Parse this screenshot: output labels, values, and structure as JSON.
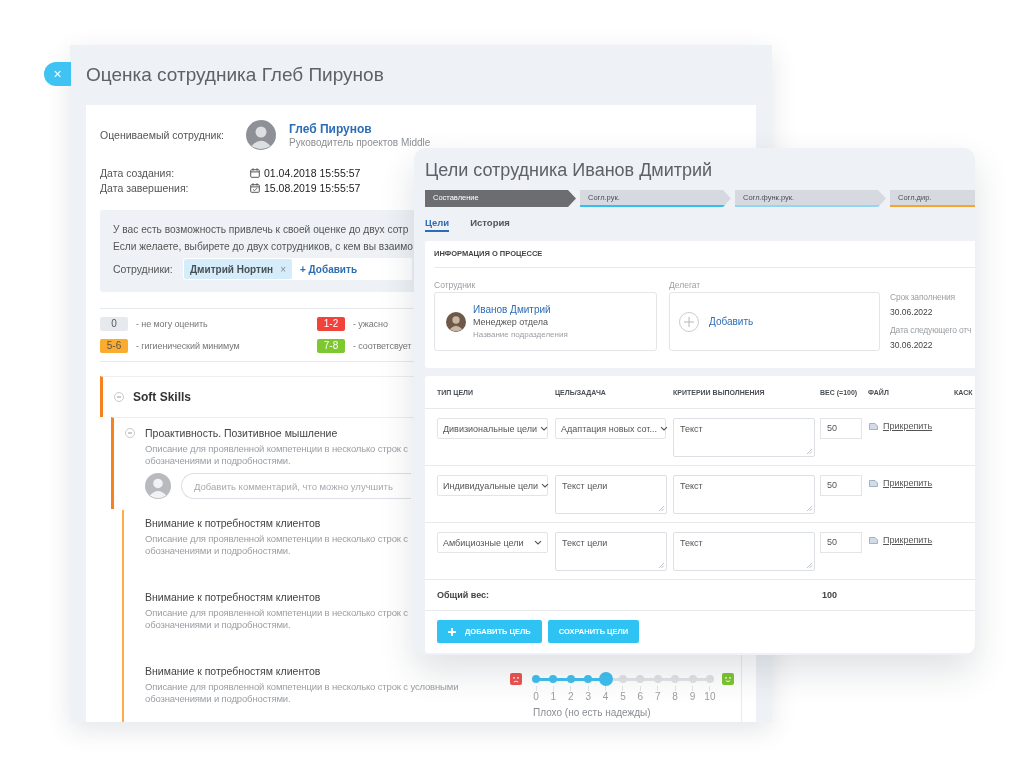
{
  "evaluation_window": {
    "close": "×",
    "title": "Оценка сотрудника Глеб Пирунов",
    "employee": {
      "label": "Оцениваемый сотрудник:",
      "name": "Глеб Пирунов",
      "role": "Руководитель проектов Middle"
    },
    "dates": [
      {
        "kind": "created",
        "label": "Дата создания:",
        "value": "01.04.2018 15:55:57"
      },
      {
        "kind": "completed",
        "label": "Дата завершения:",
        "value": "15.08.2019 15:55:57"
      }
    ],
    "invite": {
      "message": "У вас есть возможность привлечь к своей оценке до двух сотр\nЕсли желаете, выбирете до двух сотрудников, с кем вы взаимо",
      "field_label": "Сотрудники:",
      "chips": [
        {
          "name": "Дмитрий Нортин",
          "remove": "×"
        }
      ],
      "add": "+ Добавить"
    },
    "legend": [
      {
        "value": "0",
        "text": "- не могу оценить",
        "color": "#e6eaee"
      },
      {
        "value": "1-2",
        "text": "- ужасно",
        "color": "#f2433b"
      },
      {
        "value": "5-6",
        "text": "- гигиенический минимум",
        "color": "#fbac2f"
      },
      {
        "value": "7-8",
        "text": "- соответсвует",
        "color": "#7dc72f"
      }
    ],
    "competencies": [
      {
        "title": "Soft Skills",
        "expanded": true,
        "children": [
          {
            "title": "Проактивность. Позитивное мышление",
            "expanded": true,
            "description": "Описание для проявленной компетенции в несколько строк с\nобозначениями и подробностями.",
            "comment": {
              "placeholder": "Добавить комментарий, что можно улучшить"
            },
            "children": [
              {
                "title": "Внимание к потребностям клиентов",
                "description": "Описание для проявленной компетенции в несколько строк с\nобозначениями и подробностями."
              },
              {
                "title": "Внимание к потребностям клиентов",
                "description": "Описание для проявленной компетенции в несколько строк с\nобозначениями и подробностями."
              },
              {
                "title": "Внимание к потребностям клиентов",
                "description": "Описание для проявленной компетенции в несколько строк с условными\nобозначениями и подробностями.",
                "rating": {
                  "level": 0.4,
                  "scale": [
                    "0",
                    "1",
                    "2",
                    "3",
                    "4",
                    "5",
                    "6",
                    "7",
                    "8",
                    "9",
                    "10"
                  ],
                  "caption": "Плохо (но есть надежды)"
                }
              }
            ]
          }
        ]
      }
    ]
  },
  "goals_window": {
    "title": "Цели сотрудника Иванов Дмитрий",
    "steps": [
      {
        "label": "Составление",
        "selected": true
      },
      {
        "label": "Согл.рук.",
        "selected": false,
        "color": "#35bdf0"
      },
      {
        "label": "Согл.функ.рук.",
        "selected": false,
        "color": "#92d5f4"
      },
      {
        "label": "Согл.дир.",
        "selected": false,
        "color": "#f5a52a"
      }
    ],
    "tabs": [
      {
        "label": "Цели",
        "selected": true
      },
      {
        "label": "История",
        "selected": false
      }
    ],
    "process_info": {
      "heading": "ИНФОРМАЦИЯ О ПРОЦЕССЕ",
      "employee": {
        "label": "Сотрудник",
        "name": "Иванов Дмитрий",
        "position": "Менеджер отдела",
        "department": "Название подразделения"
      },
      "delegate": {
        "label": "Делегат",
        "action": "Добавить"
      },
      "dates": [
        {
          "label": "Срок заполнения",
          "value": "30.06.2022"
        },
        {
          "label": "Дата следующего отч",
          "value": "30.06.2022"
        }
      ]
    },
    "table": {
      "columns": [
        "ТИП ЦЕЛИ",
        "ЦЕЛЬ/ЗАДАЧА",
        "КРИТЕРИИ ВЫПОЛНЕНИЯ",
        "ВЕС (=100)",
        "ФАЙЛ",
        "КАСК"
      ],
      "rows": [
        {
          "type": "Дивизиональные цели",
          "goal": {
            "kind": "select",
            "value": "Адаптация новых сот..."
          },
          "criteria": "Текст",
          "weight": "50",
          "file": "Прикрепить"
        },
        {
          "type": "Индивидуальные цели",
          "goal": {
            "kind": "textarea",
            "value": "Текст цели"
          },
          "criteria": "Текст",
          "weight": "50",
          "file": "Прикрепить"
        },
        {
          "type": "Амбициозные цели",
          "goal": {
            "kind": "textarea",
            "value": "Текст цели"
          },
          "criteria": "Текст",
          "weight": "50",
          "file": "Прикрепить"
        }
      ],
      "total": {
        "label": "Общий вес:",
        "value": "100"
      }
    },
    "buttons": [
      {
        "kind": "add",
        "label": "ДОБАВИТЬ ЦЕЛЬ"
      },
      {
        "kind": "save",
        "label": "СОХРАНИТЬ ЦЕЛИ"
      }
    ]
  }
}
